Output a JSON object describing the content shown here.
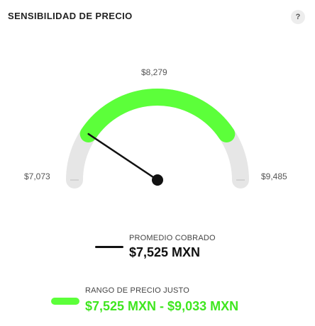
{
  "header": {
    "title": "SENSIBILIDAD DE PRECIO",
    "help_label": "?"
  },
  "gauge": {
    "min_label": "$7,073",
    "mid_label": "$8,279",
    "max_label": "$9,485",
    "min_value": 7073,
    "max_value": 9485,
    "range_start_value": 7525,
    "range_end_value": 9033,
    "needle_value": 7525,
    "track_color": "#e6e6e6",
    "range_color": "#5cff3a",
    "needle_color": "#111111"
  },
  "legend": {
    "average": {
      "label": "PROMEDIO COBRADO",
      "value": "$7,525 MXN",
      "color": "#111111"
    },
    "fair_range": {
      "label": "RANGO DE PRECIO JUSTO",
      "value": "$7,525 MXN - $9,033 MXN",
      "color": "#5cff3a"
    }
  }
}
